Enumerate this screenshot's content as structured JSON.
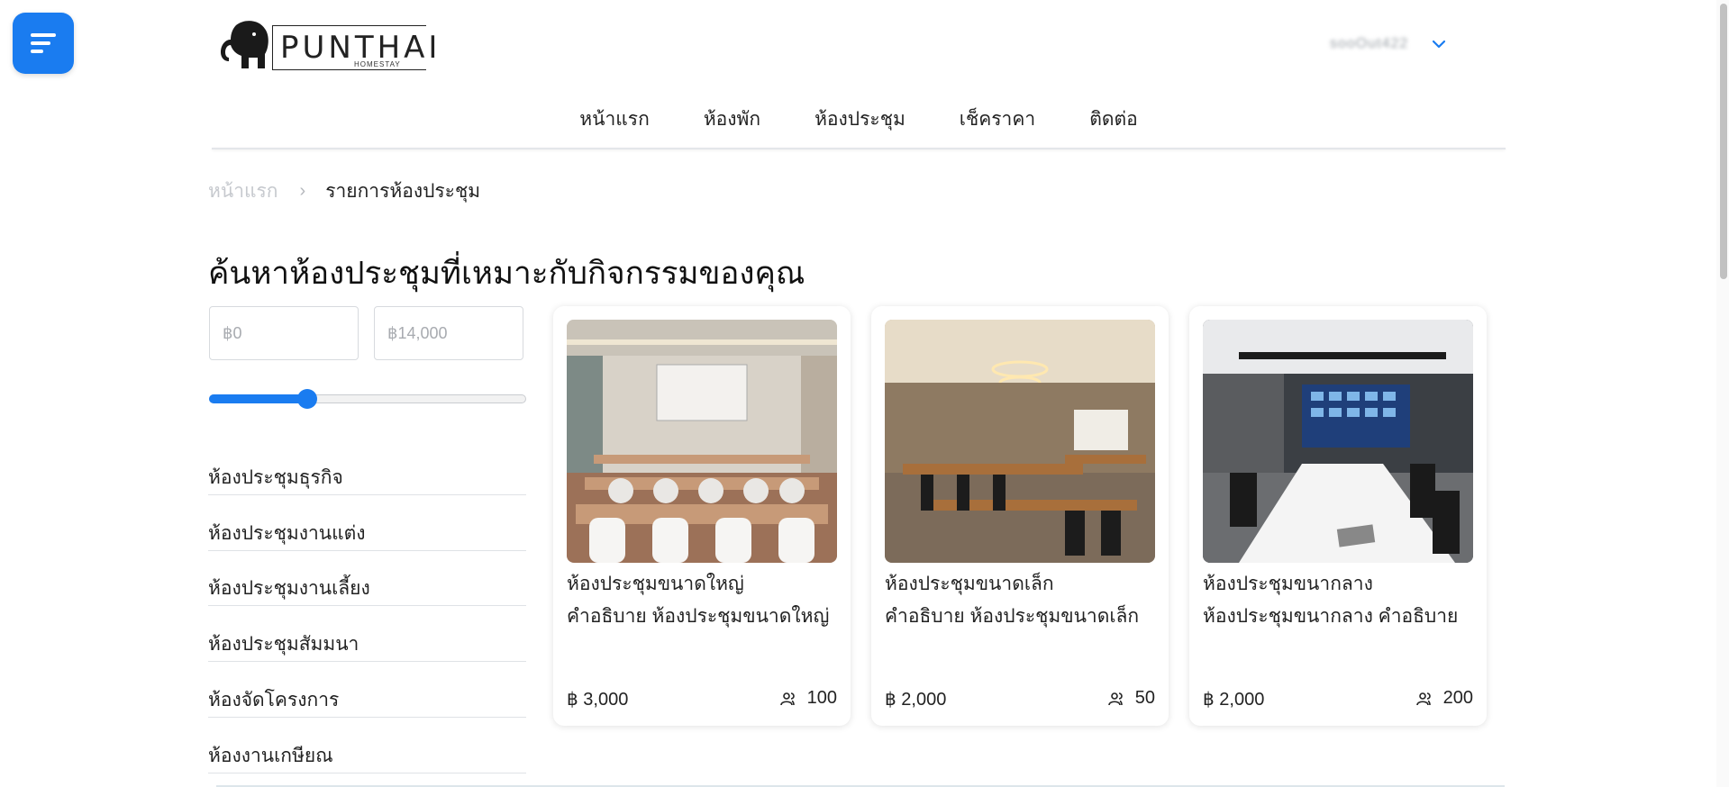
{
  "brand": {
    "name": "PUNTHAI",
    "tagline": "HOMESTAY"
  },
  "user": {
    "name": "sooOut422"
  },
  "nav": [
    {
      "label": "หน้าแรก"
    },
    {
      "label": "ห้องพัก"
    },
    {
      "label": "ห้องประชุม"
    },
    {
      "label": "เช็คราคา"
    },
    {
      "label": "ติดต่อ"
    }
  ],
  "breadcrumb": {
    "home": "หน้าแรก",
    "separator": "›",
    "current": "รายการห้องประชุม"
  },
  "page_title": "ค้นหาห้องประชุมที่เหมาะกับกิจกรรมของคุณ",
  "filter": {
    "min_placeholder": "฿0",
    "max_placeholder": "฿14,000",
    "slider_fraction": 0.31,
    "categories": [
      {
        "label": "ห้องประชุมธุรกิจ"
      },
      {
        "label": "ห้องประชุมงานแต่ง"
      },
      {
        "label": "ห้องประชุมงานเลี้ยง"
      },
      {
        "label": "ห้องประชุมสัมมนา"
      },
      {
        "label": "ห้องจัดโครงการ"
      },
      {
        "label": "ห้องงานเกษียณ"
      }
    ]
  },
  "rooms": [
    {
      "title": "ห้องประชุมขนาดใหญ่",
      "description": "คำอธิบาย ห้องประชุมขนาดใหญ่",
      "price": "฿ 3,000",
      "capacity": "100"
    },
    {
      "title": "ห้องประชุมขนาดเล็ก",
      "description": "คำอธิบาย ห้องประชุมขนาดเล็ก",
      "price": "฿ 2,000",
      "capacity": "50"
    },
    {
      "title": "ห้องประชุมขนากลาง",
      "description": "ห้องประชุมขนากลาง คำอธิบาย",
      "price": "฿ 2,000",
      "capacity": "200"
    }
  ],
  "colors": {
    "accent": "#1a7cf0",
    "text": "#222222",
    "muted": "#c6c9ce"
  }
}
